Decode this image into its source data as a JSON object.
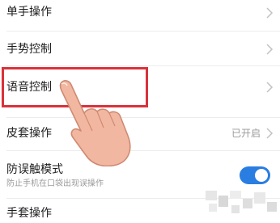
{
  "settings": {
    "rows": [
      {
        "label": "单手操作"
      },
      {
        "label": "手势控制"
      },
      {
        "label": "语音控制"
      },
      {
        "label": "皮套操作",
        "status": "已开启"
      },
      {
        "label": "防误触模式",
        "subtitle": "防止手机在口袋出现误操作",
        "toggle_on": true
      },
      {
        "label": "手套操作"
      }
    ]
  },
  "colors": {
    "accent": "#2a7de1",
    "highlight": "#d9323a",
    "skin": "#f2b7a0"
  },
  "icons": {
    "chevron": "chevron-right-icon",
    "pointer": "pointing-hand-icon"
  }
}
